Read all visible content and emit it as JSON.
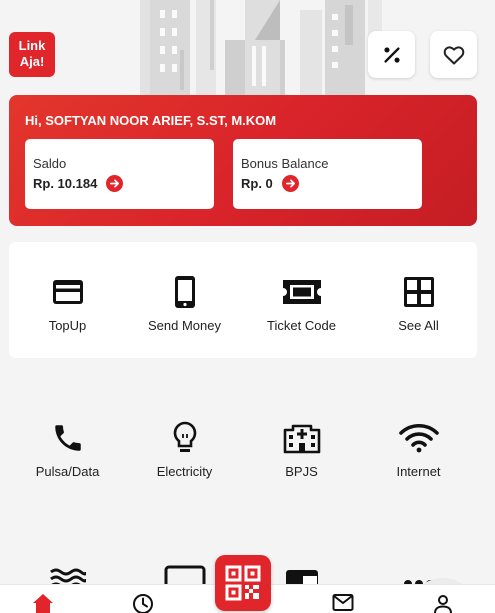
{
  "app": {
    "logo_text_line1": "Link",
    "logo_text_line2": "Aja!",
    "accent_color": "#e0262b"
  },
  "header": {
    "promo_icon": "percent-icon",
    "favorite_icon": "heart-icon"
  },
  "banner": {
    "greeting": "Hi, SOFTYAN NOOR ARIEF, S.ST, M.KOM",
    "saldo_label": "Saldo",
    "saldo_value": "Rp. 10.184",
    "bonus_label": "Bonus Balance",
    "bonus_value": "Rp. 0"
  },
  "main_menu": [
    {
      "label": "TopUp",
      "icon": "credit-card-icon"
    },
    {
      "label": "Send Money",
      "icon": "smartphone-icon"
    },
    {
      "label": "Ticket Code",
      "icon": "ticket-icon"
    },
    {
      "label": "See All",
      "icon": "grid-icon"
    }
  ],
  "services": [
    {
      "label": "Pulsa/Data",
      "icon": "phone-icon"
    },
    {
      "label": "Electricity",
      "icon": "lightbulb-icon"
    },
    {
      "label": "BPJS",
      "icon": "hospital-icon"
    },
    {
      "label": "Internet",
      "icon": "wifi-icon"
    }
  ],
  "services_row3_icons": [
    "waves-icon",
    "tv-icon",
    "wallet-icon",
    "more-icon"
  ],
  "bottom_nav": [
    {
      "name": "home",
      "icon": "home-icon",
      "active": true
    },
    {
      "name": "history",
      "icon": "clock-icon",
      "active": false
    },
    {
      "name": "scan",
      "icon": "qr-code-icon",
      "active": false
    },
    {
      "name": "inbox",
      "icon": "mail-icon",
      "active": false
    },
    {
      "name": "account",
      "icon": "person-icon",
      "active": false
    }
  ]
}
